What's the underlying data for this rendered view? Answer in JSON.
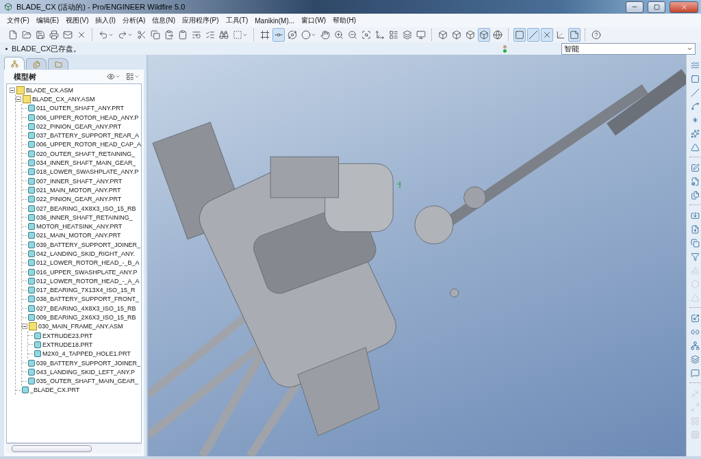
{
  "window": {
    "title": "BLADE_CX (活动的) - Pro/ENGINEER Wildfire 5.0"
  },
  "menu": [
    "文件(F)",
    "编辑(E)",
    "视图(V)",
    "插入(I)",
    "分析(A)",
    "信息(N)",
    "应用程序(P)",
    "工具(T)",
    "Manikin(M)...",
    "窗口(W)",
    "帮助(H)"
  ],
  "toolbar": [
    {
      "pressed": false
    },
    {
      "pressed": false
    },
    {
      "pressed": false
    },
    {
      "pressed": false
    },
    {
      "pressed": false
    },
    {
      "pressed": false
    },
    {
      "pressed": false
    },
    {
      "pressed": false
    },
    {
      "pressed": false
    },
    {
      "pressed": false
    },
    {
      "pressed": false
    },
    {
      "pressed": false
    },
    {
      "pressed": false
    },
    {
      "pressed": false
    },
    {
      "pressed": false
    },
    {
      "pressed": false
    },
    {
      "pressed": false
    },
    {
      "pressed": true
    },
    {
      "pressed": false
    },
    {
      "pressed": false
    },
    {
      "pressed": false
    },
    {
      "pressed": false
    },
    {
      "pressed": false
    },
    {
      "pressed": false
    },
    {
      "pressed": false
    },
    {
      "pressed": false
    },
    {
      "pressed": false
    },
    {
      "pressed": false
    },
    {
      "pressed": false
    },
    {
      "pressed": false
    },
    {
      "pressed": false
    },
    {
      "pressed": true
    },
    {
      "pressed": false
    },
    {
      "pressed": true
    },
    {
      "pressed": true
    },
    {
      "pressed": true
    },
    {
      "pressed": false
    },
    {
      "pressed": true
    },
    {
      "pressed": false
    }
  ],
  "message": "BLADE_CX已存盘。",
  "filter": {
    "value": "智能"
  },
  "nav_tabs": [
    {
      "selected": true
    },
    {
      "selected": false
    },
    {
      "selected": false
    }
  ],
  "model_tree": {
    "title": "模型树",
    "items": [
      {
        "label": "BLADE_CX.ASM",
        "kind": "asm",
        "expanded": true,
        "children": [
          {
            "label": "BLADE_CX_ANY.ASM",
            "kind": "asm",
            "expanded": true,
            "children": [
              {
                "label": "011_OUTER_SHAFT_ANY.PRT",
                "kind": "prt"
              },
              {
                "label": "006_UPPER_ROTOR_HEAD_ANY.P",
                "kind": "prt"
              },
              {
                "label": "022_PINION_GEAR_ANY.PRT",
                "kind": "prt"
              },
              {
                "label": "037_BATTERY_SUPPORT_REAR_A",
                "kind": "prt"
              },
              {
                "label": "006_UPPER_ROTOR_HEAD_CAP_A",
                "kind": "prt"
              },
              {
                "label": "020_OUTER_SHAFT_RETAINING_",
                "kind": "prt"
              },
              {
                "label": "034_INNER_SHAFT_MAIN_GEAR_",
                "kind": "prt"
              },
              {
                "label": "018_LOWER_SWASHPLATE_ANY.P",
                "kind": "prt"
              },
              {
                "label": "007_INNER_SHAFT_ANY.PRT",
                "kind": "prt"
              },
              {
                "label": "021_MAIN_MOTOR_ANY.PRT",
                "kind": "prt"
              },
              {
                "label": "022_PINION_GEAR_ANY.PRT",
                "kind": "prt"
              },
              {
                "label": "027_BEARING_4X8X3_ISO_15_RB",
                "kind": "prt"
              },
              {
                "label": "036_INNER_SHAFT_RETAINING_",
                "kind": "prt"
              },
              {
                "label": "MOTOR_HEATSINK_ANY.PRT",
                "kind": "prt"
              },
              {
                "label": "021_MAIN_MOTOR_ANY.PRT",
                "kind": "prt"
              },
              {
                "label": "039_BATTERY_SUPPORT_JOINER_",
                "kind": "prt"
              },
              {
                "label": "042_LANDING_SKID_RIGHT_ANY.",
                "kind": "prt"
              },
              {
                "label": "012_LOWER_ROTOR_HEAD_-_B_A",
                "kind": "prt"
              },
              {
                "label": "016_UPPER_SWASHPLATE_ANY.P",
                "kind": "prt"
              },
              {
                "label": "012_LOWER_ROTOR_HEAD_-_A_A",
                "kind": "prt"
              },
              {
                "label": "017_BEARING_7X13X4_ISO_15_R",
                "kind": "prt"
              },
              {
                "label": "038_BATTERY_SUPPORT_FRONT_",
                "kind": "prt"
              },
              {
                "label": "027_BEARING_4X8X3_ISO_15_RB",
                "kind": "prt"
              },
              {
                "label": "009_BEARING_2X6X3_ISO_15_RB",
                "kind": "prt"
              },
              {
                "label": "030_MAIN_FRAME_ANY.ASM",
                "kind": "asm",
                "expanded": true,
                "children": [
                  {
                    "label": "EXTRUDE23.PRT",
                    "kind": "prt"
                  },
                  {
                    "label": "EXTRUDE18.PRT",
                    "kind": "prt"
                  },
                  {
                    "label": "M2X0_4_TAPPED_HOLE1.PRT",
                    "kind": "prt"
                  }
                ]
              },
              {
                "label": "039_BATTERY_SUPPORT_JOINER_",
                "kind": "prt"
              },
              {
                "label": "043_LANDING_SKID_LEFT_ANY.P",
                "kind": "prt"
              },
              {
                "label": "035_OUTER_SHAFT_MAIN_GEAR_",
                "kind": "prt"
              }
            ]
          },
          {
            "label": "_BLADE_CX.PRT",
            "kind": "prt"
          }
        ]
      }
    ]
  },
  "right_toolbar": [
    {
      "disabled": false
    },
    {
      "disabled": false
    },
    {
      "disabled": false
    },
    {
      "disabled": false
    },
    {
      "disabled": false
    },
    {
      "disabled": false
    },
    {
      "disabled": false
    },
    {
      "disabled": false
    },
    {
      "disabled": false
    },
    {
      "disabled": false
    },
    {
      "disabled": false
    },
    {
      "disabled": false
    },
    {
      "disabled": false
    },
    {
      "disabled": false
    },
    {
      "disabled": true
    },
    {
      "disabled": true
    },
    {
      "disabled": true
    },
    {
      "disabled": false
    },
    {
      "disabled": false
    },
    {
      "disabled": false
    },
    {
      "disabled": false
    },
    {
      "disabled": false
    },
    {
      "disabled": true
    },
    {
      "disabled": true
    },
    {
      "disabled": true
    },
    {
      "disabled": true
    }
  ]
}
